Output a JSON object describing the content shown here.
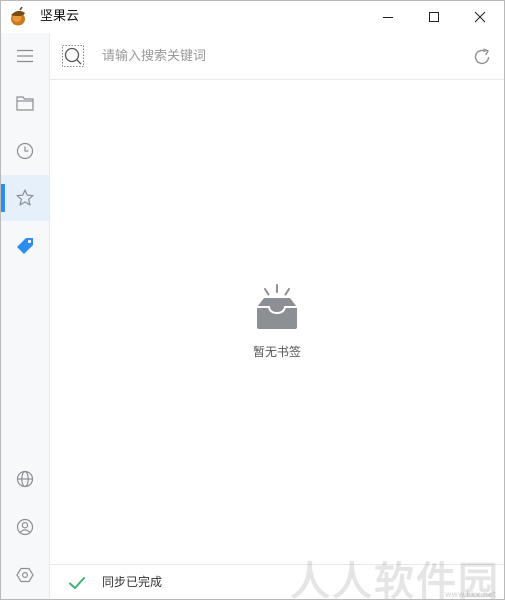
{
  "window": {
    "title": "坚果云"
  },
  "titlebar_controls": {
    "minimize": "minimize-icon",
    "maximize": "maximize-icon",
    "close": "close-icon"
  },
  "sidebar": {
    "items": [
      {
        "name": "menu",
        "icon": "hamburger-menu-icon"
      },
      {
        "name": "files",
        "icon": "folder-icon"
      },
      {
        "name": "recent",
        "icon": "clock-icon"
      },
      {
        "name": "bookmarks",
        "icon": "star-icon",
        "active": true
      },
      {
        "name": "tags",
        "icon": "tag-icon"
      }
    ],
    "bottom_items": [
      {
        "name": "web",
        "icon": "globe-icon"
      },
      {
        "name": "account",
        "icon": "user-icon"
      },
      {
        "name": "settings",
        "icon": "settings-icon"
      }
    ]
  },
  "search": {
    "placeholder": "请输入搜索关键词",
    "value": ""
  },
  "empty_state": {
    "text": "暂无书签",
    "icon": "empty-inbox-icon"
  },
  "status": {
    "text": "同步已完成",
    "icon": "checkmark-icon"
  },
  "watermark": {
    "text": "人人软件园",
    "url": "www.kkx.net"
  },
  "colors": {
    "accent": "#2d8cf0",
    "success": "#3cb371",
    "sidebar_bg": "#f7f8fa",
    "active_bg": "#e6f0fb",
    "icon_gray": "#8c8f94"
  }
}
